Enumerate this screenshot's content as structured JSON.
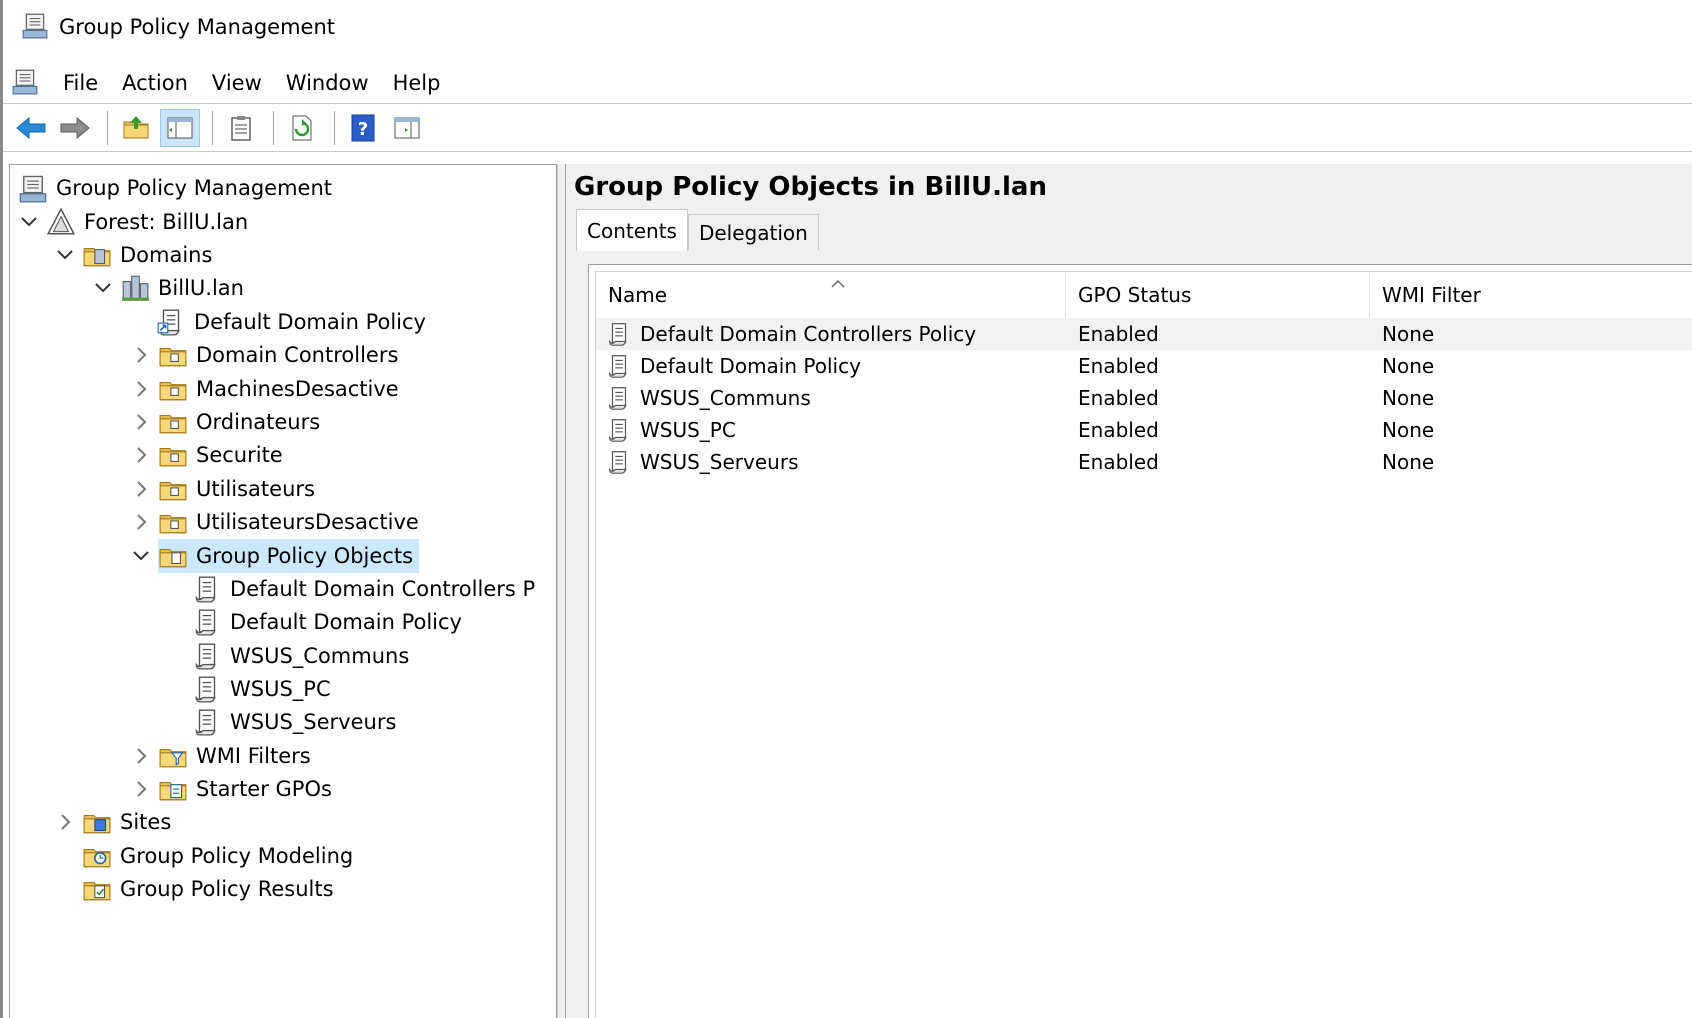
{
  "window": {
    "title": "Group Policy Management"
  },
  "menu": {
    "items": [
      "File",
      "Action",
      "View",
      "Window",
      "Help"
    ]
  },
  "toolbar": {
    "buttons": [
      "back-icon",
      "forward-icon",
      "up-folder-icon",
      "show-hide-tree-icon",
      "properties-icon",
      "refresh-icon",
      "help-icon",
      "show-action-pane-icon"
    ]
  },
  "tree": {
    "root": "Group Policy Management",
    "forest": "Forest: BillU.lan",
    "domains": "Domains",
    "domain": "BillU.lan",
    "default_domain_policy": "Default Domain Policy",
    "ous": [
      "Domain Controllers",
      "MachinesDesactive",
      "Ordinateurs",
      "Securite",
      "Utilisateurs",
      "UtilisateursDesactive"
    ],
    "gpo_container": "Group Policy Objects",
    "gpos": [
      "Default Domain Controllers P",
      "Default Domain Policy",
      "WSUS_Communs",
      "WSUS_PC",
      "WSUS_Serveurs"
    ],
    "wmi_filters": "WMI Filters",
    "starter_gpos": "Starter GPOs",
    "sites": "Sites",
    "modeling": "Group Policy Modeling",
    "results": "Group Policy Results"
  },
  "right": {
    "title": "Group Policy Objects in BillU.lan",
    "tabs": [
      "Contents",
      "Delegation"
    ],
    "columns": [
      "Name",
      "GPO Status",
      "WMI Filter"
    ],
    "rows": [
      {
        "name": "Default Domain Controllers Policy",
        "status": "Enabled",
        "wmi": "None"
      },
      {
        "name": "Default Domain Policy",
        "status": "Enabled",
        "wmi": "None"
      },
      {
        "name": "WSUS_Communs",
        "status": "Enabled",
        "wmi": "None"
      },
      {
        "name": "WSUS_PC",
        "status": "Enabled",
        "wmi": "None"
      },
      {
        "name": "WSUS_Serveurs",
        "status": "Enabled",
        "wmi": "None"
      }
    ]
  },
  "colors": {
    "selection": "#cce8ff",
    "toolbar_active": "#cce4f7",
    "folder": "#e8c15a",
    "accent_blue": "#1a73c8"
  }
}
